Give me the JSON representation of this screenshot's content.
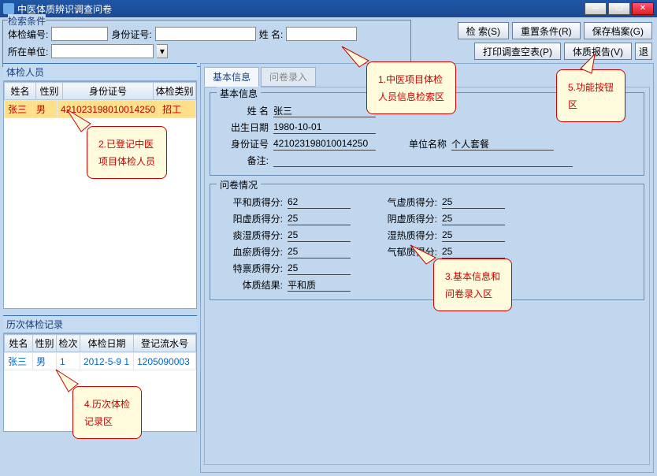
{
  "window": {
    "title": "中医体质辨识调查问卷"
  },
  "search": {
    "group_label": "检索条件",
    "field1_label": "体检编号:",
    "field1_value": "",
    "field2_label": "身份证号:",
    "field2_value": "",
    "field3_label": "姓    名:",
    "field3_value": "",
    "field4_label": "所在单位:",
    "field4_value": ""
  },
  "buttons": {
    "search": "检    索(S)",
    "reset": "重置条件(R)",
    "save": "保存档案(G)",
    "print": "打印调查空表(P)",
    "report": "体质报告(V)",
    "exit": "退"
  },
  "panel1": {
    "title": "体检人员",
    "headers": [
      "姓名",
      "性别",
      "身份证号",
      "体检类别"
    ],
    "row": [
      "张三",
      "男",
      "421023198010014250",
      "招工"
    ]
  },
  "panel2": {
    "title": "历次体检记录",
    "headers": [
      "姓名",
      "性别",
      "检次",
      "体检日期",
      "登记流水号"
    ],
    "row": [
      "张三",
      "男",
      "1",
      "2012-5-9 1",
      "1205090003"
    ]
  },
  "tabs": {
    "t1": "基本信息",
    "t2": "问卷录入"
  },
  "basic": {
    "legend": "基本信息",
    "name_label": "姓    名",
    "name": "张三",
    "birth_label": "出生日期",
    "birth": "1980-10-01",
    "id_label": "身份证号",
    "id": "421023198010014250",
    "unit_label": "单位名称",
    "unit": "个人套餐",
    "note_label": "备注:",
    "note": ""
  },
  "survey": {
    "legend": "问卷情况",
    "r1a": "平和质得分:",
    "v1a": "62",
    "r1b": "气虚质得分:",
    "v1b": "25",
    "r2a": "阳虚质得分:",
    "v2a": "25",
    "r2b": "阴虚质得分:",
    "v2b": "25",
    "r3a": "痰湿质得分:",
    "v3a": "25",
    "r3b": "湿热质得分:",
    "v3b": "25",
    "r4a": "血瘀质得分:",
    "v4a": "25",
    "r4b": "气郁质得分:",
    "v4b": "25",
    "r5a": "特禀质得分:",
    "v5a": "25",
    "result_label": "体质结果:",
    "result": "平和质"
  },
  "callouts": {
    "c1": "1.中医项目体检\n人员信息检索区",
    "c2": "2.已登记中医\n项目体检人员",
    "c3": "3.基本信息和\n问卷录入区",
    "c4": "4.历次体检\n记录区",
    "c5": "5.功能按钮\n区"
  }
}
